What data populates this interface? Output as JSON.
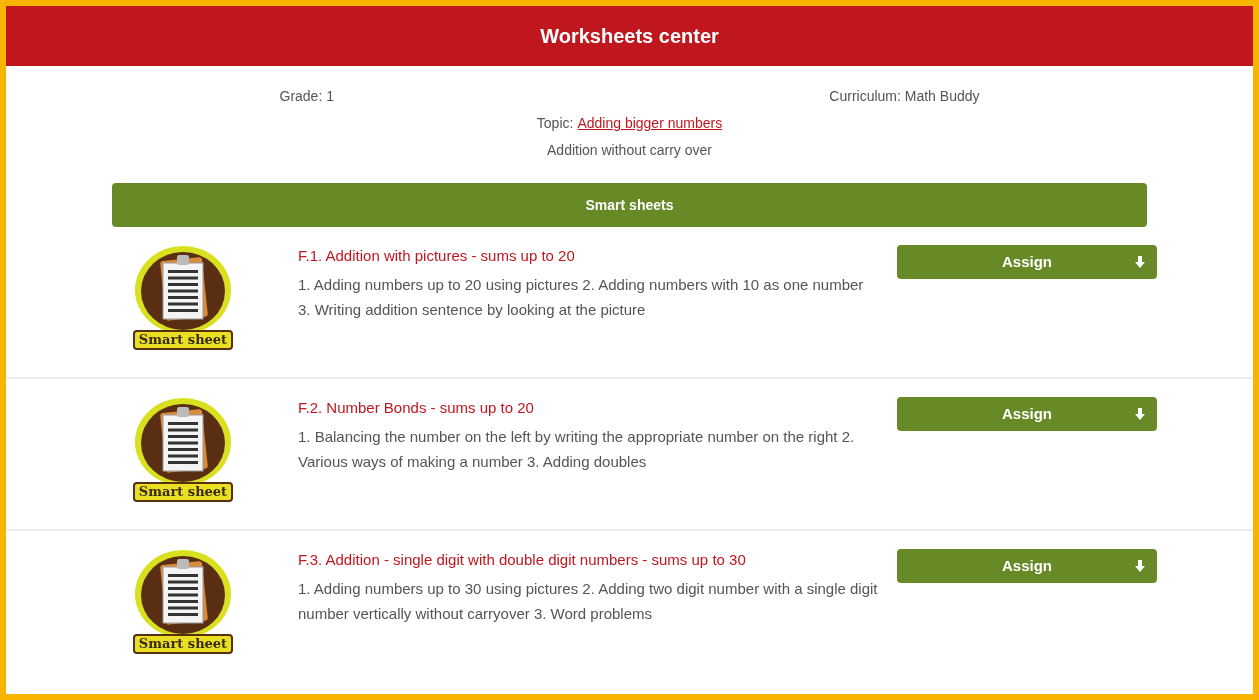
{
  "header": {
    "title": "Worksheets center"
  },
  "info": {
    "grade": "Grade: 1",
    "curriculum": "Curriculum: Math Buddy",
    "topic_label": "Topic:",
    "topic_link": "Adding bigger numbers",
    "subtopic": "Addition without carry over"
  },
  "section": {
    "title": "Smart sheets"
  },
  "worksheets": [
    {
      "badge": "Smart sheet",
      "title": "F.1. Addition with pictures - sums up to 20",
      "description": "1. Adding numbers up to 20 using pictures 2. Adding numbers with 10 as one number 3. Writing addition sentence by looking at the picture",
      "button": "Assign"
    },
    {
      "badge": "Smart sheet",
      "title": "F.2. Number Bonds - sums up to 20",
      "description": "1. Balancing the number on the left by writing the appropriate number on the right 2. Various ways of making a number 3. Adding doubles",
      "button": "Assign"
    },
    {
      "badge": "Smart sheet",
      "title": "F.3. Addition - single digit with double digit numbers - sums up to 30",
      "description": "1. Adding numbers up to 30 using pictures 2. Adding two digit number with a single digit number vertically without carryover 3. Word problems",
      "button": "Assign"
    }
  ]
}
